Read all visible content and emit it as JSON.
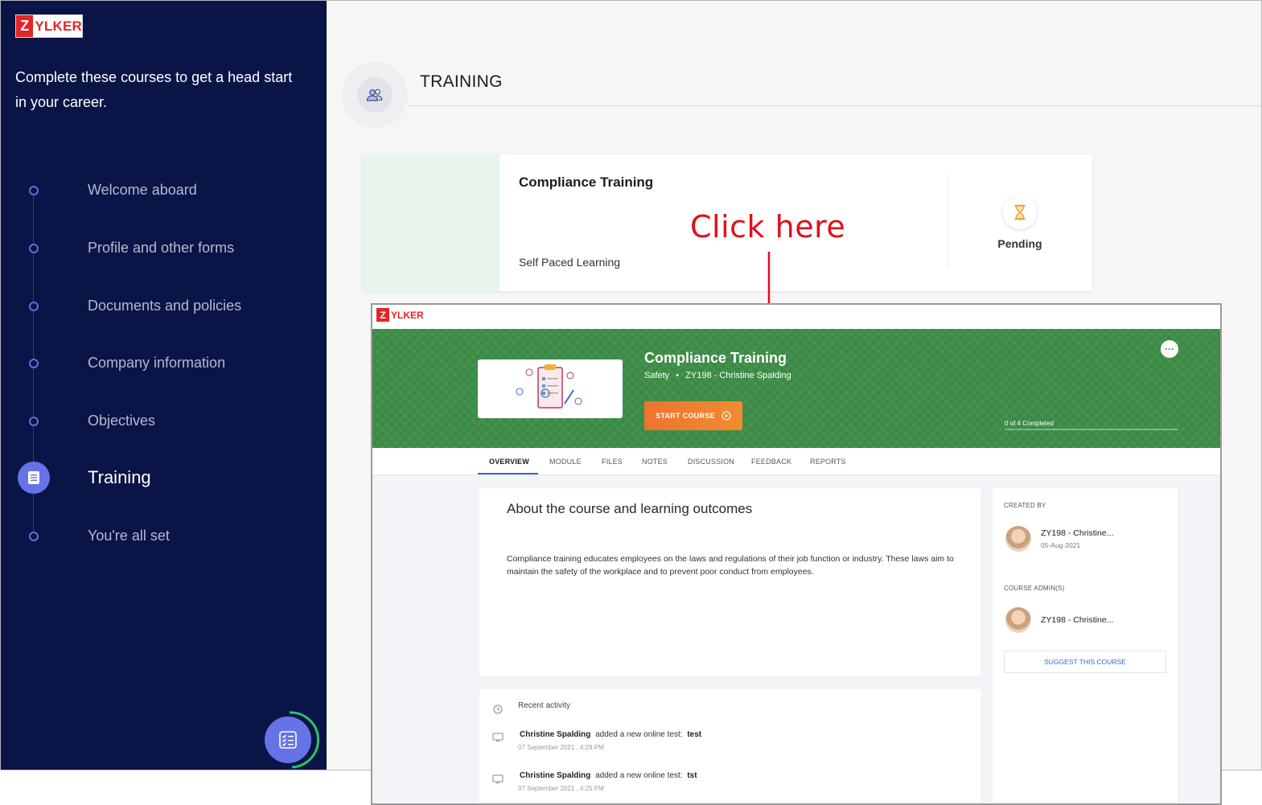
{
  "sidebar": {
    "logo": {
      "z": "Z",
      "rest": "YLKER"
    },
    "tagline": "Complete these courses to get a head start in your career.",
    "steps": [
      {
        "label": "Welcome aboard"
      },
      {
        "label": "Profile and other forms"
      },
      {
        "label": "Documents and policies"
      },
      {
        "label": "Company information"
      },
      {
        "label": "Objectives"
      },
      {
        "label": "Training"
      },
      {
        "label": "You're all set"
      }
    ],
    "active_step": "Training"
  },
  "main": {
    "title": "TRAINING",
    "course": {
      "title": "Compliance Training",
      "type": "Self Paced Learning",
      "status": "Pending"
    }
  },
  "annotation": {
    "text": "Click here",
    "color": "#e0101a"
  },
  "course_page": {
    "logo": {
      "z": "Z",
      "rest": "YLKER"
    },
    "title": "Compliance Training",
    "category": "Safety",
    "separator": "•",
    "author": "ZY198 - Christine Spalding",
    "start_button": "START COURSE",
    "progress": {
      "label": "0 of 4 Completed",
      "completed": 0,
      "total": 4
    },
    "tabs": [
      "OVERVIEW",
      "MODULE",
      "FILES",
      "NOTES",
      "DISCUSSION",
      "FEEDBACK",
      "REPORTS"
    ],
    "active_tab": "OVERVIEW",
    "about": {
      "title": "About the course and learning outcomes",
      "text": "Compliance training educates employees on the laws and regulations of their job function or industry. These laws aim to maintain the safety of the workplace and to prevent poor conduct from employees."
    },
    "activity": {
      "title": "Recent activity",
      "items": [
        {
          "user": "Christine Spalding",
          "action": "added a new online test:",
          "target": "test",
          "time": "07 September 2021 , 4:29 PM"
        },
        {
          "user": "Christine Spalding",
          "action": "added a new online test:",
          "target": "tst",
          "time": "07 September 2021 , 4:25 PM"
        }
      ]
    },
    "side": {
      "created_by_label": "CREATED BY",
      "creator_name": "ZY198 - Christine...",
      "creator_date": "05-Aug-2021",
      "admins_label": "COURSE ADMIN(S)",
      "admin_name": "ZY198 - Christine...",
      "suggest_button": "SUGGEST THIS COURSE"
    }
  },
  "colors": {
    "sidebar_bg": "#0b1446",
    "accent": "#6673e6",
    "banner_green": "#3b8a45",
    "start_orange": "#ee7330",
    "brand_red": "#e42527"
  }
}
